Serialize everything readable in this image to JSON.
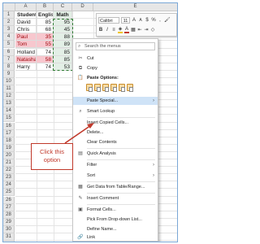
{
  "columns": [
    "A",
    "B",
    "C",
    "D",
    "E"
  ],
  "rows": [
    "1",
    "2",
    "3",
    "4",
    "5",
    "6",
    "7",
    "8",
    "9",
    "10",
    "11",
    "12",
    "13",
    "14",
    "15",
    "16",
    "17",
    "18",
    "19",
    "20",
    "21",
    "22",
    "23",
    "24",
    "25",
    "26",
    "27",
    "28",
    "29",
    "30",
    "31",
    "32"
  ],
  "table": {
    "headers": [
      "Student",
      "English",
      "Math"
    ],
    "students": [
      {
        "name": "David",
        "english": "85",
        "math": "95"
      },
      {
        "name": "Chris",
        "english": "68",
        "math": "45"
      },
      {
        "name": "Paul",
        "english": "35",
        "math": "88"
      },
      {
        "name": "Tom",
        "english": "55",
        "math": "89"
      },
      {
        "name": "Holland",
        "english": "74",
        "math": "85"
      },
      {
        "name": "Natasha",
        "english": "58",
        "math": "85"
      },
      {
        "name": "Harry",
        "english": "74",
        "math": "53"
      }
    ]
  },
  "mini_toolbar": {
    "font": "Calibri",
    "size": "11",
    "grow": "A",
    "shrink": "A",
    "currency": "$",
    "percent": "%",
    "comma": ",",
    "bold": "B",
    "italic": "I",
    "underline": "≡",
    "font_color": "A"
  },
  "context_menu": {
    "search_placeholder": "Search the menus",
    "cut": "Cut",
    "copy": "Copy",
    "paste_options": "Paste Options:",
    "paste_special": "Paste Special...",
    "smart_lookup": "Smart Lookup",
    "insert_copied": "Insert Copied Cells...",
    "delete": "Delete...",
    "clear_contents": "Clear Contents",
    "quick_analysis": "Quick Analysis",
    "filter": "Filter",
    "sort": "Sort",
    "get_data": "Get Data from Table/Range...",
    "insert_comment": "Insert Comment",
    "format_cells": "Format Cells...",
    "pick_dropdown": "Pick From Drop-down List...",
    "define_name": "Define Name...",
    "link": "Link"
  },
  "callout": {
    "line1": "Click this",
    "line2": "option",
    "color": "#c0392b"
  },
  "colors": {
    "highlight": "#cfe3f7",
    "pink_fill": "#f7c7ce",
    "selection_border": "#2e7d32"
  }
}
